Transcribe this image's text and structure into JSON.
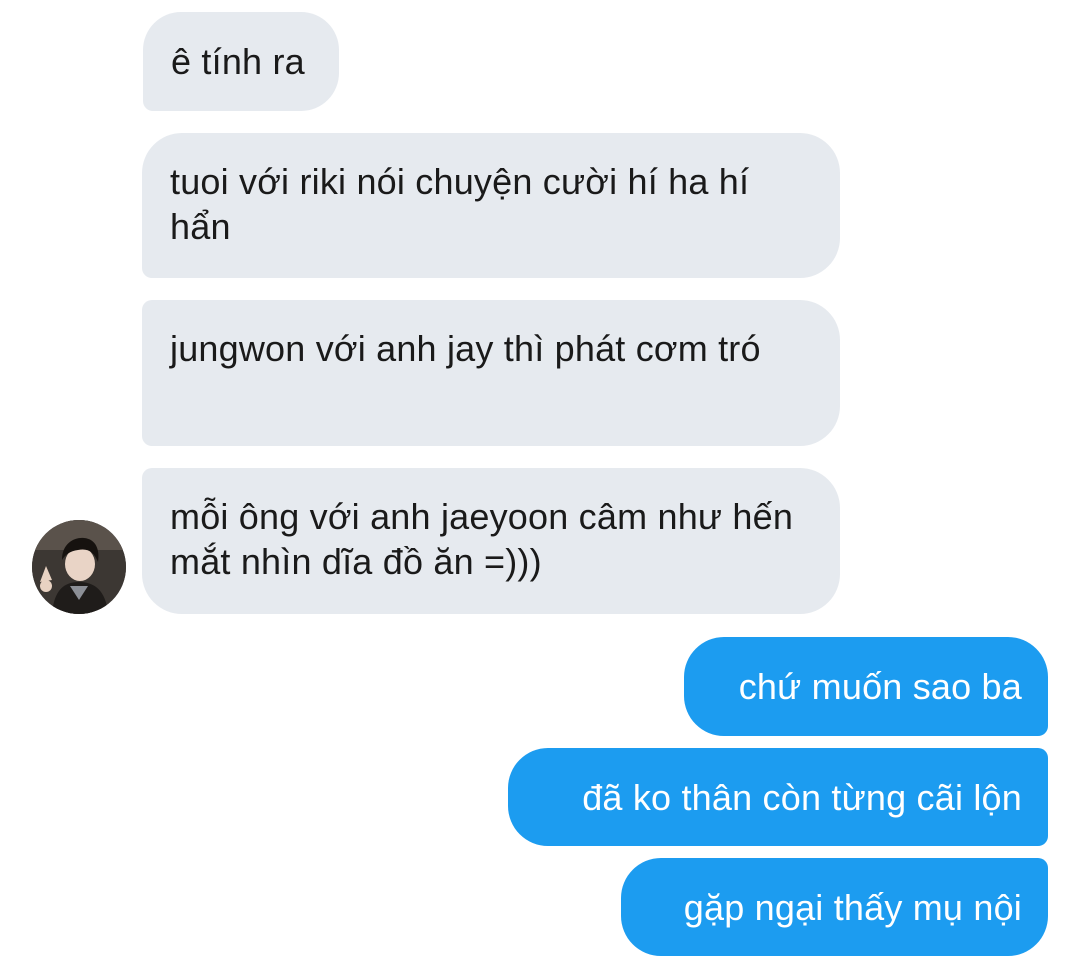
{
  "conversation": {
    "incoming": [
      {
        "text": "ê tính ra"
      },
      {
        "text": "tuoi với riki nói chuyện cười hí ha hí hẩn"
      },
      {
        "text": "jungwon với anh jay thì phát cơm tró"
      },
      {
        "text": "mỗi ông với anh jaeyoon câm như hến mắt nhìn dĩa đồ ăn =)))"
      }
    ],
    "outgoing": [
      {
        "text": "chứ muốn sao ba"
      },
      {
        "text": "đã ko thân còn từng cãi lộn"
      },
      {
        "text": "gặp ngại thấy mụ nội"
      }
    ]
  },
  "colors": {
    "incoming_bubble": "#e6eaef",
    "outgoing_bubble": "#1c9cf0",
    "incoming_text": "#1a1a1a",
    "outgoing_text": "#ffffff"
  },
  "avatar": {
    "icon": "contact-photo"
  }
}
